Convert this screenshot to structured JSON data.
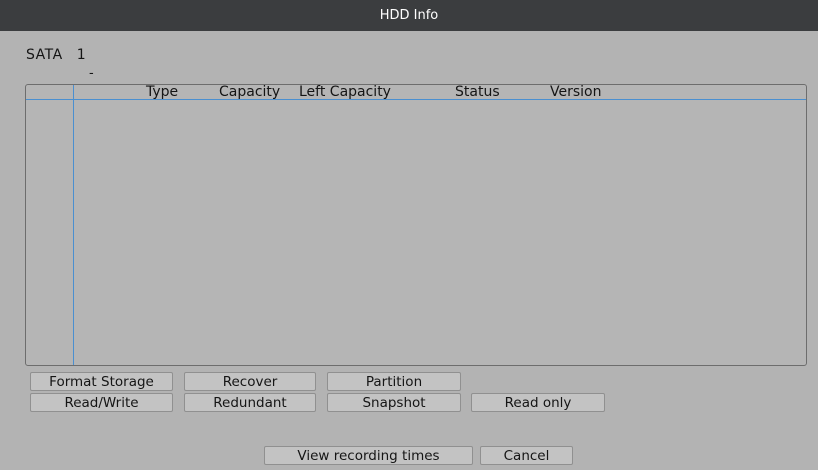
{
  "window": {
    "title": "HDD Info"
  },
  "sata": {
    "label": "SATA",
    "number": "1",
    "dash": "-"
  },
  "table": {
    "columns": [
      "Type",
      "Capacity",
      "Left Capacity",
      "Status",
      "Version"
    ],
    "rows": []
  },
  "buttons": {
    "format_storage": "Format Storage",
    "recover": "Recover",
    "partition": "Partition",
    "read_write": "Read/Write",
    "redundant": "Redundant",
    "snapshot": "Snapshot",
    "read_only": "Read only",
    "view_recording_times": "View recording times",
    "cancel": "Cancel"
  }
}
